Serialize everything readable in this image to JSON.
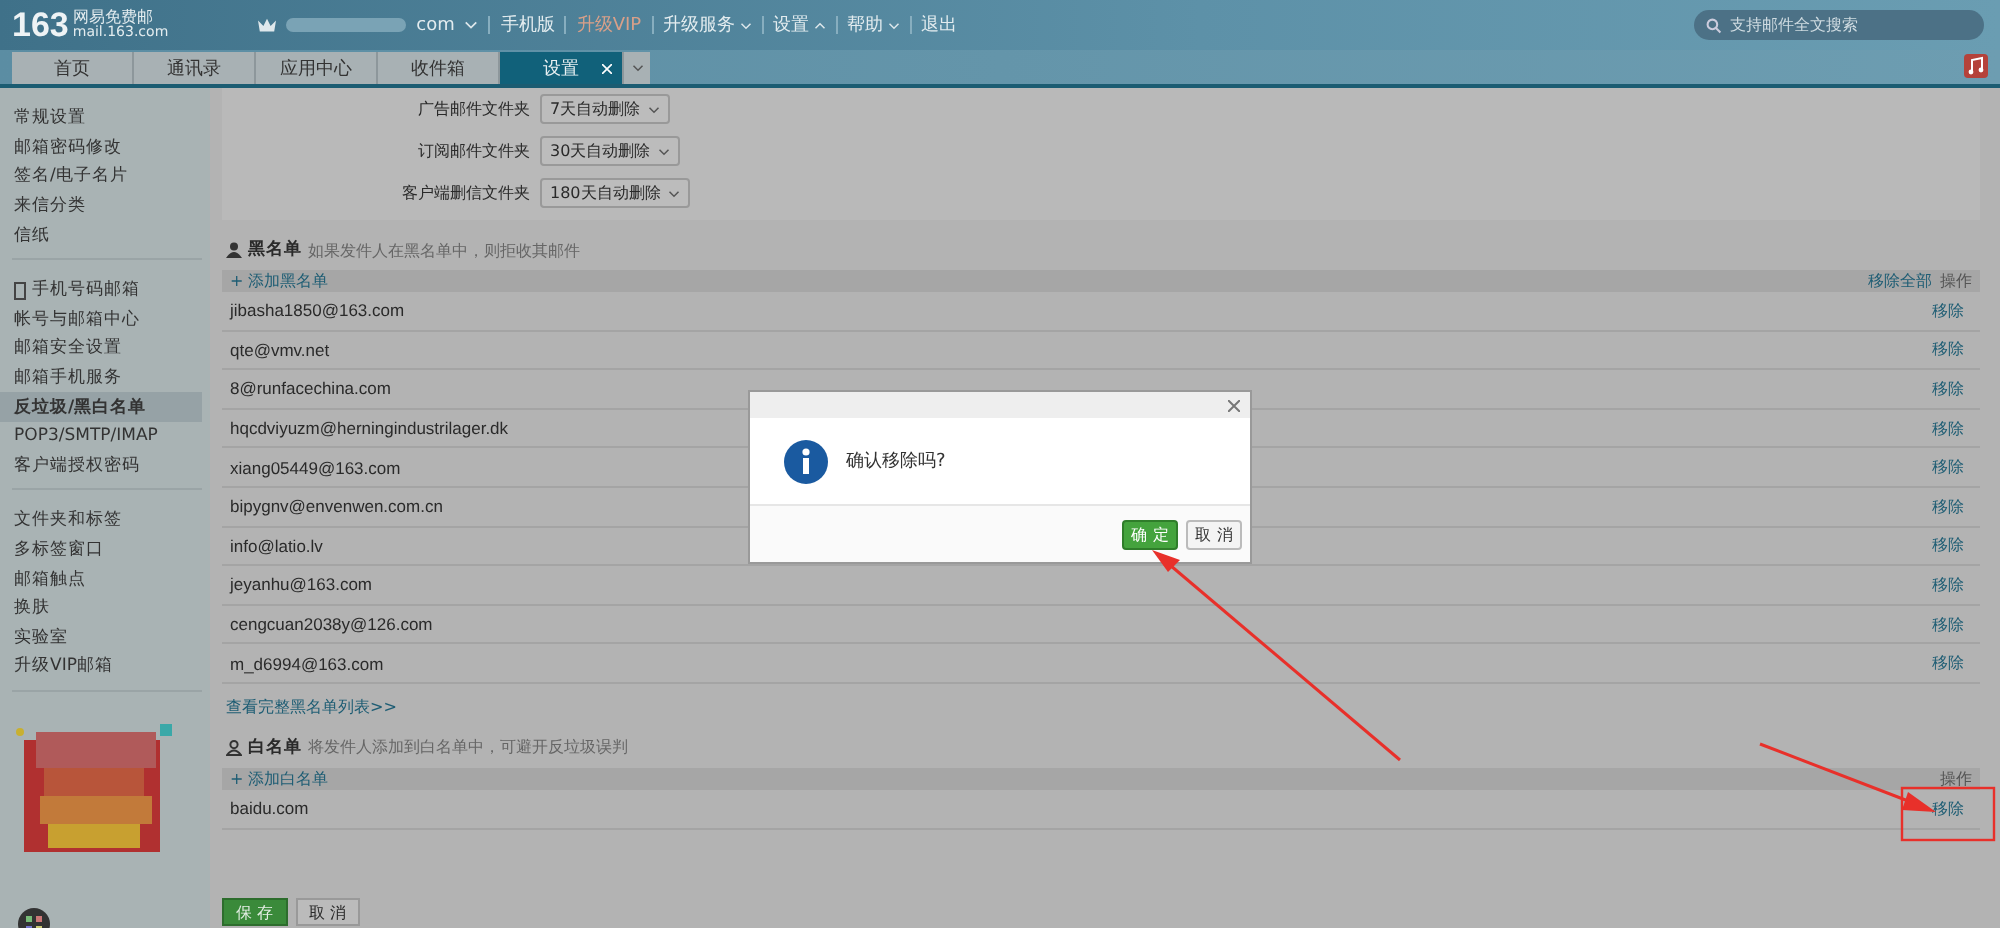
{
  "header": {
    "logo": "163",
    "logo_title": "网易免费邮",
    "logo_domain": "mail.163.com",
    "account": "com",
    "nav": [
      {
        "label": "手机版",
        "kind": "link",
        "vip": false
      },
      {
        "label": "升级VIP",
        "kind": "link",
        "vip": true
      },
      {
        "label": "升级服务",
        "kind": "menu",
        "expanded": false,
        "vip": false
      },
      {
        "label": "设置",
        "kind": "menu",
        "expanded": true,
        "vip": false
      },
      {
        "label": "帮助",
        "kind": "menu",
        "expanded": false,
        "vip": false
      },
      {
        "label": "退出",
        "kind": "link",
        "vip": false
      }
    ],
    "search": {
      "placeholder": "支持邮件全文搜索"
    }
  },
  "tabs": [
    {
      "label": "首页",
      "selected": false,
      "closable": false
    },
    {
      "label": "通讯录",
      "selected": false,
      "closable": false
    },
    {
      "label": "应用中心",
      "selected": false,
      "closable": false
    },
    {
      "label": "收件箱",
      "selected": false,
      "closable": false
    },
    {
      "label": "设置",
      "selected": true,
      "closable": true
    }
  ],
  "sidebar": {
    "groups": [
      [
        {
          "label": "常规设置",
          "selected": false,
          "phone": false
        },
        {
          "label": "邮箱密码修改",
          "selected": false,
          "phone": false
        },
        {
          "label": "签名/电子名片",
          "selected": false,
          "phone": false
        },
        {
          "label": "来信分类",
          "selected": false,
          "phone": false
        },
        {
          "label": "信纸",
          "selected": false,
          "phone": false
        }
      ],
      [
        {
          "label": "手机号码邮箱",
          "selected": false,
          "phone": true
        },
        {
          "label": "帐号与邮箱中心",
          "selected": false,
          "phone": false
        },
        {
          "label": "邮箱安全设置",
          "selected": false,
          "phone": false
        },
        {
          "label": "邮箱手机服务",
          "selected": false,
          "phone": false
        },
        {
          "label": "反垃圾/黑白名单",
          "selected": true,
          "phone": false
        },
        {
          "label": "POP3/SMTP/IMAP",
          "selected": false,
          "phone": false
        },
        {
          "label": "客户端授权密码",
          "selected": false,
          "phone": false
        }
      ],
      [
        {
          "label": "文件夹和标签",
          "selected": false,
          "phone": false
        },
        {
          "label": "多标签窗口",
          "selected": false,
          "phone": false
        },
        {
          "label": "邮箱触点",
          "selected": false,
          "phone": false
        },
        {
          "label": "换肤",
          "selected": false,
          "phone": false
        },
        {
          "label": "实验室",
          "selected": false,
          "phone": false
        },
        {
          "label": "升级VIP邮箱",
          "selected": false,
          "phone": false
        }
      ]
    ]
  },
  "folder_settings": [
    {
      "label": "广告邮件文件夹",
      "value": "7天自动删除"
    },
    {
      "label": "订阅邮件文件夹",
      "value": "30天自动删除"
    },
    {
      "label": "客户端删信文件夹",
      "value": "180天自动删除"
    }
  ],
  "blacklist": {
    "title": "黑名单",
    "hint": "如果发件人在黑名单中，则拒收其邮件",
    "add": "+ 添加黑名单",
    "remove_all": "移除全部",
    "action_header": "操作",
    "rows": [
      {
        "address": "jibasha1850@163.com",
        "action": "移除"
      },
      {
        "address": "qte@vmv.net",
        "action": "移除"
      },
      {
        "address": "8@runfacechina.com",
        "action": "移除"
      },
      {
        "address": "hqcdviyuzm@herningindustrilager.dk",
        "action": "移除"
      },
      {
        "address": "xiang05449@163.com",
        "action": "移除"
      },
      {
        "address": "bipygnv@envenwen.com.cn",
        "action": "移除"
      },
      {
        "address": "info@latio.lv",
        "action": "移除"
      },
      {
        "address": "jeyanhu@163.com",
        "action": "移除"
      },
      {
        "address": "cengcuan2038y@126.com",
        "action": "移除"
      },
      {
        "address": "m_d6994@163.com",
        "action": "移除"
      }
    ],
    "more": "查看完整黑名单列表>>"
  },
  "whitelist": {
    "title": "白名单",
    "hint": "将发件人添加到白名单中，可避开反垃圾误判",
    "add": "+ 添加白名单",
    "action_header": "操作",
    "rows": [
      {
        "address": "baidu.com",
        "action": "移除"
      }
    ]
  },
  "footer_buttons": [
    {
      "label": "保 存",
      "primary": true
    },
    {
      "label": "取 消",
      "primary": false
    }
  ],
  "dialog": {
    "message": "确认移除吗?",
    "buttons": [
      {
        "label": "确 定",
        "primary": true
      },
      {
        "label": "取 消",
        "primary": false
      }
    ]
  }
}
